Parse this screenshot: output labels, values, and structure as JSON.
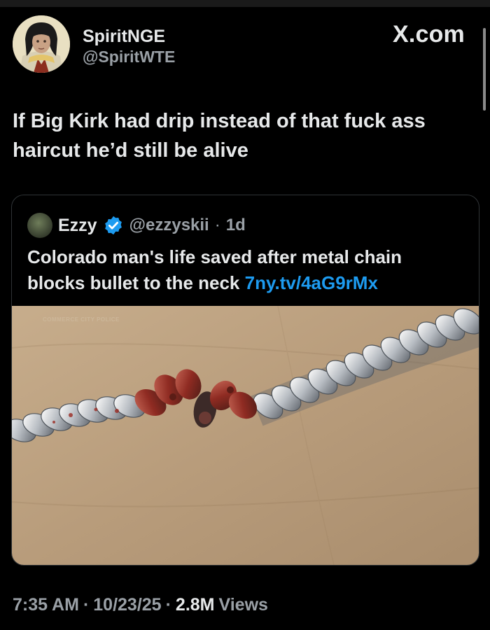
{
  "header": {
    "display_name": "SpiritNGE",
    "handle": "@SpiritWTE",
    "brand": "X.com",
    "avatar_icon": "avatar-anime-character-icon"
  },
  "tweet": {
    "text": "If Big Kirk had drip instead of that fuck ass haircut he’d still be alive"
  },
  "quote": {
    "name": "Ezzy",
    "handle": "@ezzyskii",
    "separator": "·",
    "time": "1d",
    "text": "Colorado man's life saved after metal chain blocks bullet to the neck",
    "link": "7ny.tv/4aG9rMx",
    "media_watermark": "COMMERCE CITY POLICE",
    "verified_color": "#1d9bf0"
  },
  "meta": {
    "time": "7:35 AM",
    "sep1": "·",
    "date": "10/23/25",
    "sep2": "·",
    "views_count": "2.8M",
    "views_label": "Views"
  },
  "colors": {
    "background": "#000000",
    "text": "#e7e9ea",
    "secondary": "#9aa0a6",
    "link": "#1d9bf0",
    "border": "#2f3336"
  }
}
